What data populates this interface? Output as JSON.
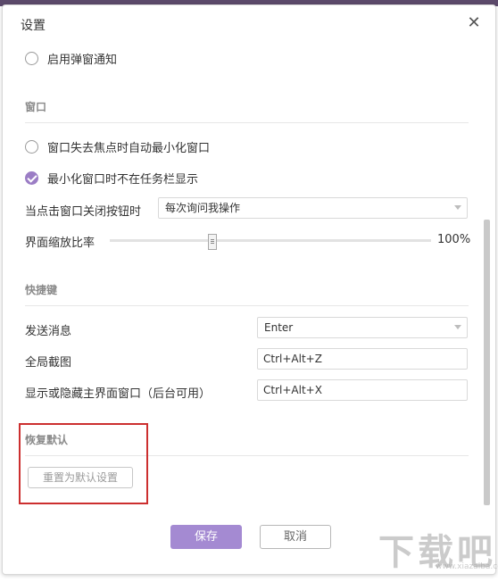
{
  "dialog": {
    "title": "设置",
    "close_icon": "close-icon"
  },
  "notifications": {
    "enable_popup": {
      "label": "启用弹窗通知",
      "checked": false
    }
  },
  "window_section": {
    "header": "窗口",
    "auto_minimize": {
      "label": "窗口失去焦点时自动最小化窗口",
      "checked": false
    },
    "hide_taskbar": {
      "label": "最小化窗口时不在任务栏显示",
      "checked": true
    },
    "close_button": {
      "label": "当点击窗口关闭按钮时",
      "value": "每次询问我操作"
    },
    "zoom": {
      "label": "界面缩放比率",
      "value_text": "100%",
      "slider_position": 0.32
    }
  },
  "shortcuts_section": {
    "header": "快捷键",
    "send_message": {
      "label": "发送消息",
      "value": "Enter"
    },
    "screenshot": {
      "label": "全局截图",
      "value": "Ctrl+Alt+Z"
    },
    "toggle_main": {
      "label": "显示或隐藏主界面窗口（后台可用）",
      "value": "Ctrl+Alt+X"
    }
  },
  "restore_section": {
    "header": "恢复默认",
    "reset_button": "重置为默认设置"
  },
  "footer": {
    "save_label": "保存",
    "cancel_label": "取消"
  },
  "watermark": {
    "main": "下载吧",
    "sub": "www.xiazaiba.com"
  },
  "colors": {
    "accent": "#9b7dc5",
    "save_button": "#a48ad2",
    "highlight_frame": "#cc2f2f",
    "topbar": "#5c4a6b"
  }
}
